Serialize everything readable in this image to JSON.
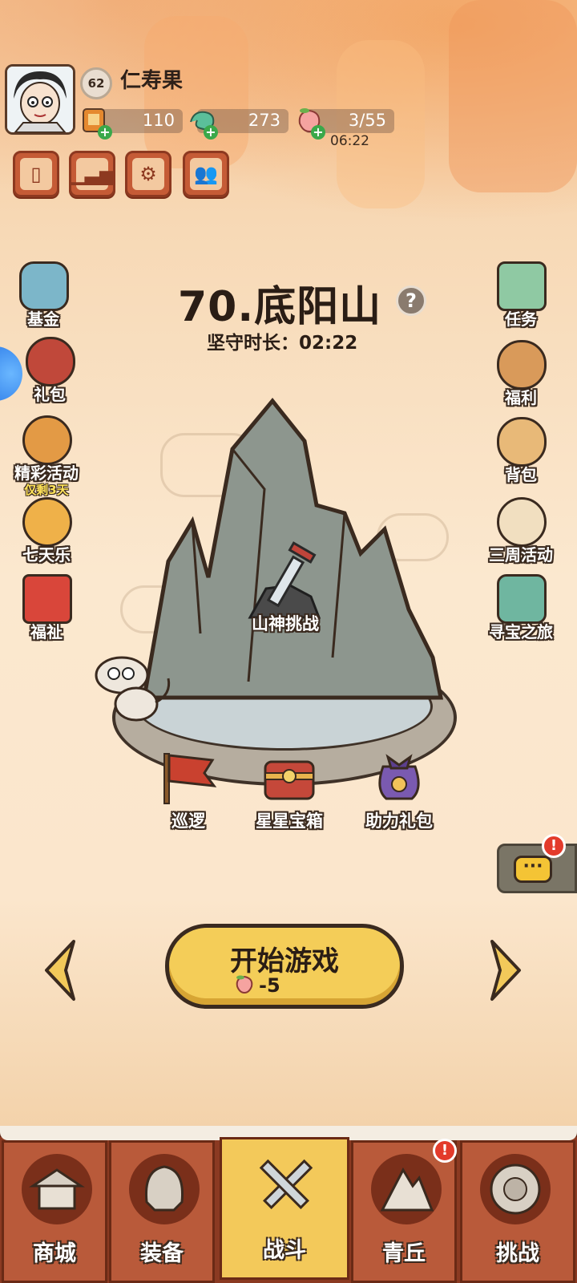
{
  "player": {
    "name": "仁寿果",
    "level": "62",
    "currencies": [
      {
        "name": "ticket",
        "value": "110"
      },
      {
        "name": "jade-dragon",
        "value": "273"
      },
      {
        "name": "peach-stamina",
        "value": "3/55"
      }
    ],
    "stamina_timer": "06:22"
  },
  "quick_buttons": [
    "cards-icon",
    "rank-icon",
    "settings-icon",
    "friends-icon"
  ],
  "stage": {
    "title": "70.底阳山",
    "guard_time": "坚守时长：02:22"
  },
  "left_menu": [
    {
      "label": "基金"
    },
    {
      "label": "礼包"
    },
    {
      "label": "精彩活动",
      "sub": "仅剩3天"
    },
    {
      "label": "七天乐"
    },
    {
      "label": "福祉"
    }
  ],
  "right_menu": [
    {
      "label": "任务"
    },
    {
      "label": "福利"
    },
    {
      "label": "背包"
    },
    {
      "label": "三周活动"
    },
    {
      "label": "寻宝之旅"
    }
  ],
  "scene_nodes": {
    "boss": "山神挑战",
    "patrol": "巡逻",
    "star_chest": "星星宝箱",
    "assist_pack": "助力礼包"
  },
  "start": {
    "label": "开始游戏",
    "cost": "-5"
  },
  "alerts": {
    "chat": "!",
    "qingqiu": "!"
  },
  "nav": {
    "tabs": [
      {
        "label": "商城"
      },
      {
        "label": "装备"
      },
      {
        "label": "战斗"
      },
      {
        "label": "青丘"
      },
      {
        "label": "挑战"
      }
    ],
    "active": "战斗"
  },
  "colors": {
    "accent_yellow": "#f4cd58",
    "nav_red": "#b95a3a",
    "nav_active": "#f3c95a",
    "outline": "#3a2a1f"
  }
}
